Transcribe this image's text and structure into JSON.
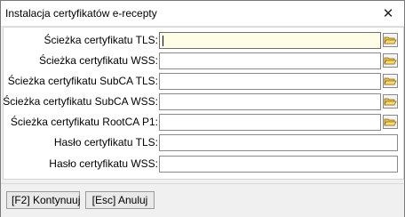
{
  "window": {
    "title": "Instalacja certyfikatów e-recepty",
    "close_glyph": "✕"
  },
  "fields": [
    {
      "label": "Ścieżka certyfikatu TLS:",
      "value": "",
      "has_browse": true,
      "focused": true,
      "browse_icon": "folder-open-icon"
    },
    {
      "label": "Ścieżka certyfikatu WSS:",
      "value": "",
      "has_browse": true,
      "focused": false,
      "browse_icon": "folder-open-icon"
    },
    {
      "label": "Ścieżka certyfikatu SubCA TLS:",
      "value": "",
      "has_browse": true,
      "focused": false,
      "browse_icon": "folder-open-icon"
    },
    {
      "label": "Ścieżka certyfikatu SubCA WSS:",
      "value": "",
      "has_browse": true,
      "focused": false,
      "browse_icon": "folder-open-icon"
    },
    {
      "label": "Ścieżka certyfikatu RootCA P1:",
      "value": "",
      "has_browse": true,
      "focused": false,
      "browse_icon": "folder-open-icon"
    },
    {
      "label": "Hasło certyfikatu TLS:",
      "value": "",
      "has_browse": false,
      "focused": false
    },
    {
      "label": "Hasło certyfikatu WSS:",
      "value": "",
      "has_browse": false,
      "focused": false
    }
  ],
  "footer": {
    "continue_label": "[F2] Kontynuuj",
    "cancel_label": "[Esc] Anuluj"
  },
  "colors": {
    "focused_field": "#fffde6",
    "folder_icon": "#e8c24a"
  }
}
